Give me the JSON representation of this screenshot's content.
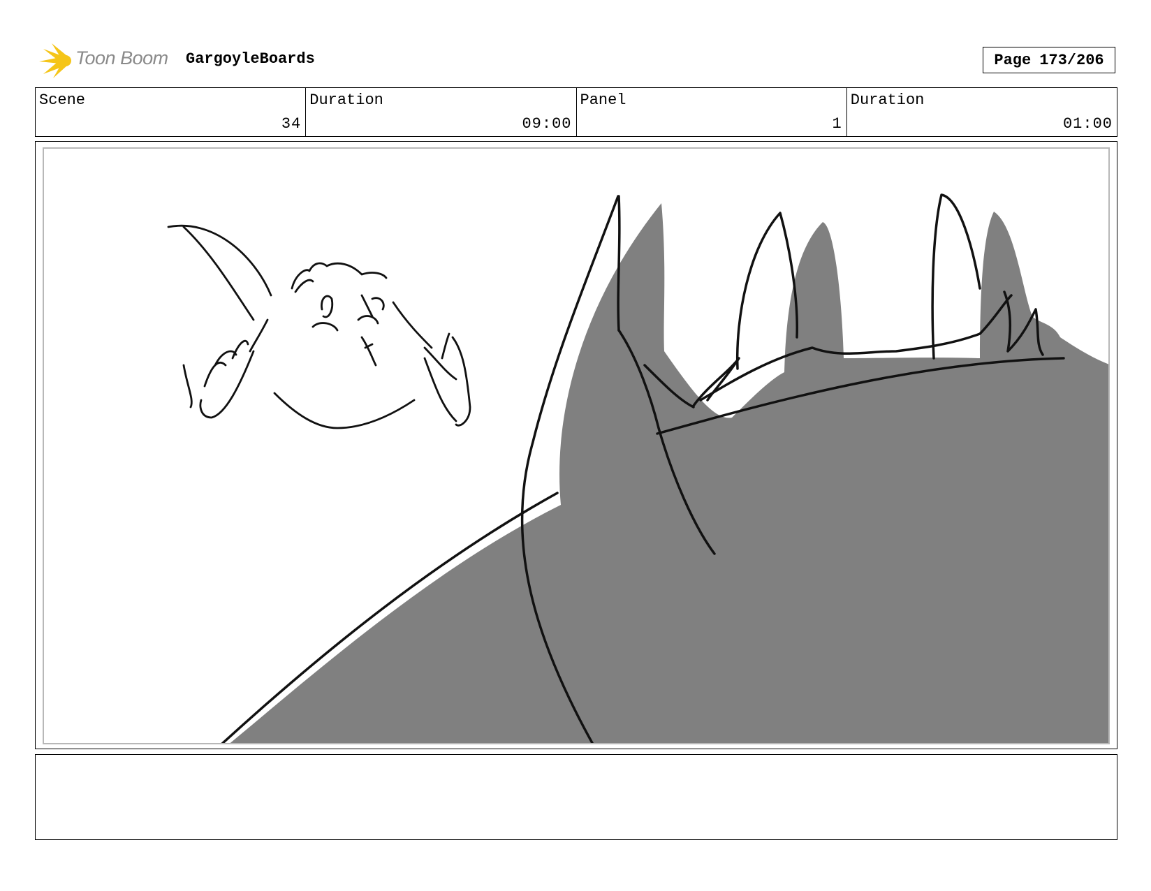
{
  "header": {
    "logo_text": "Toon Boom",
    "project_title": "GargoyleBoards",
    "page_label": "Page",
    "page_number": "173/206"
  },
  "info": {
    "scene_label": "Scene",
    "scene_value": "34",
    "scene_duration_label": "Duration",
    "scene_duration_value": "09:00",
    "panel_label": "Panel",
    "panel_value": "1",
    "panel_duration_label": "Duration",
    "panel_duration_value": "01:00"
  },
  "notes": {
    "text": ""
  },
  "colors": {
    "shadow_fill": "#808080",
    "line": "#111111",
    "logo_yellow": "#f5c518",
    "logo_text": "#8a8a8a"
  }
}
